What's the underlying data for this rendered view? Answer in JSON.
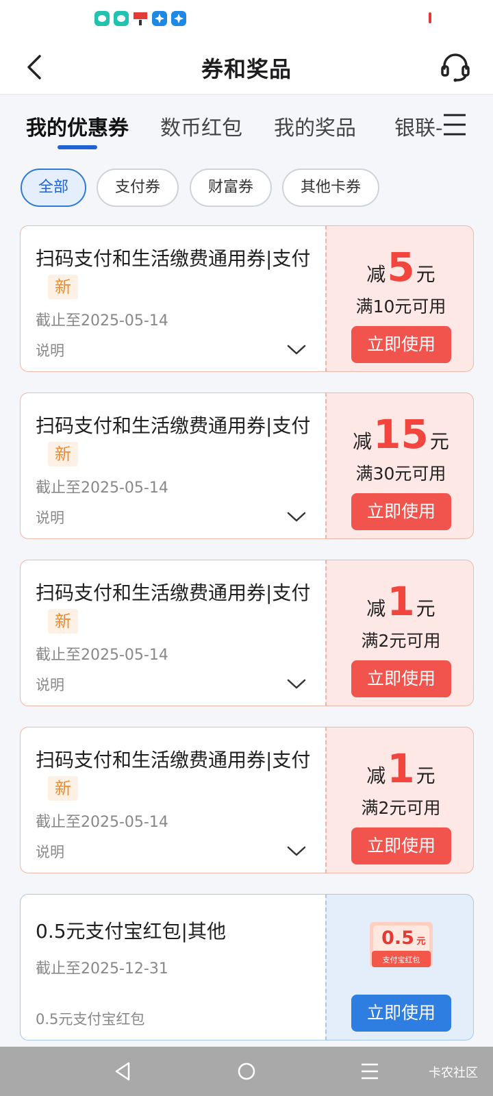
{
  "status_bar": {
    "icons": [
      "chat-icon",
      "chat-icon",
      "espn-icon",
      "puzzle-icon",
      "puzzle-icon"
    ],
    "icon_colors": [
      "#21c3b0",
      "#21c3b0",
      "#e53935",
      "#1e88e5",
      "#1e88e5"
    ]
  },
  "header": {
    "title": "券和奖品",
    "back_icon": "chevron-left-icon",
    "service_icon": "headset-icon"
  },
  "tabs": [
    {
      "label": "我的优惠券",
      "active": true
    },
    {
      "label": "数币红包",
      "active": false
    },
    {
      "label": "我的奖品",
      "active": false
    },
    {
      "label": "银联-",
      "active": false
    }
  ],
  "filters": [
    {
      "label": "全部",
      "active": true
    },
    {
      "label": "支付券",
      "active": false
    },
    {
      "label": "财富券",
      "active": false
    },
    {
      "label": "其他卡券",
      "active": false
    }
  ],
  "coupons": [
    {
      "title": "扫码支付和生活缴费通用券|支付",
      "badge": "新",
      "date": "截止至2025-05-14",
      "desc": "说明",
      "prefix": "减",
      "amount": "5",
      "unit": "元",
      "condition": "满10元可用",
      "button": "立即使用"
    },
    {
      "title": "扫码支付和生活缴费通用券|支付",
      "badge": "新",
      "date": "截止至2025-05-14",
      "desc": "说明",
      "prefix": "减",
      "amount": "15",
      "unit": "元",
      "condition": "满30元可用",
      "button": "立即使用"
    },
    {
      "title": "扫码支付和生活缴费通用券|支付",
      "badge": "新",
      "date": "截止至2025-05-14",
      "desc": "说明",
      "prefix": "减",
      "amount": "1",
      "unit": "元",
      "condition": "满2元可用",
      "button": "立即使用"
    },
    {
      "title": "扫码支付和生活缴费通用券|支付",
      "badge": "新",
      "date": "截止至2025-05-14",
      "desc": "说明",
      "prefix": "减",
      "amount": "1",
      "unit": "元",
      "condition": "满2元可用",
      "button": "立即使用"
    },
    {
      "title": "0.5元支付宝红包|其他",
      "date": "截止至2025-12-31",
      "desc": "0.5元支付宝红包",
      "image_amount": "0.5",
      "image_unit": "元",
      "image_label": "支付宝红包",
      "button": "立即使用"
    }
  ],
  "nav_bar": {
    "buttons": [
      "back-triangle-icon",
      "home-circle-icon",
      "menu-lines-icon"
    ],
    "watermark": "卡农社区"
  },
  "colors": {
    "accent_blue": "#1f63d6",
    "coupon_red": "#f1453d",
    "button_red": "#f1534d",
    "button_blue": "#2e7de0"
  }
}
